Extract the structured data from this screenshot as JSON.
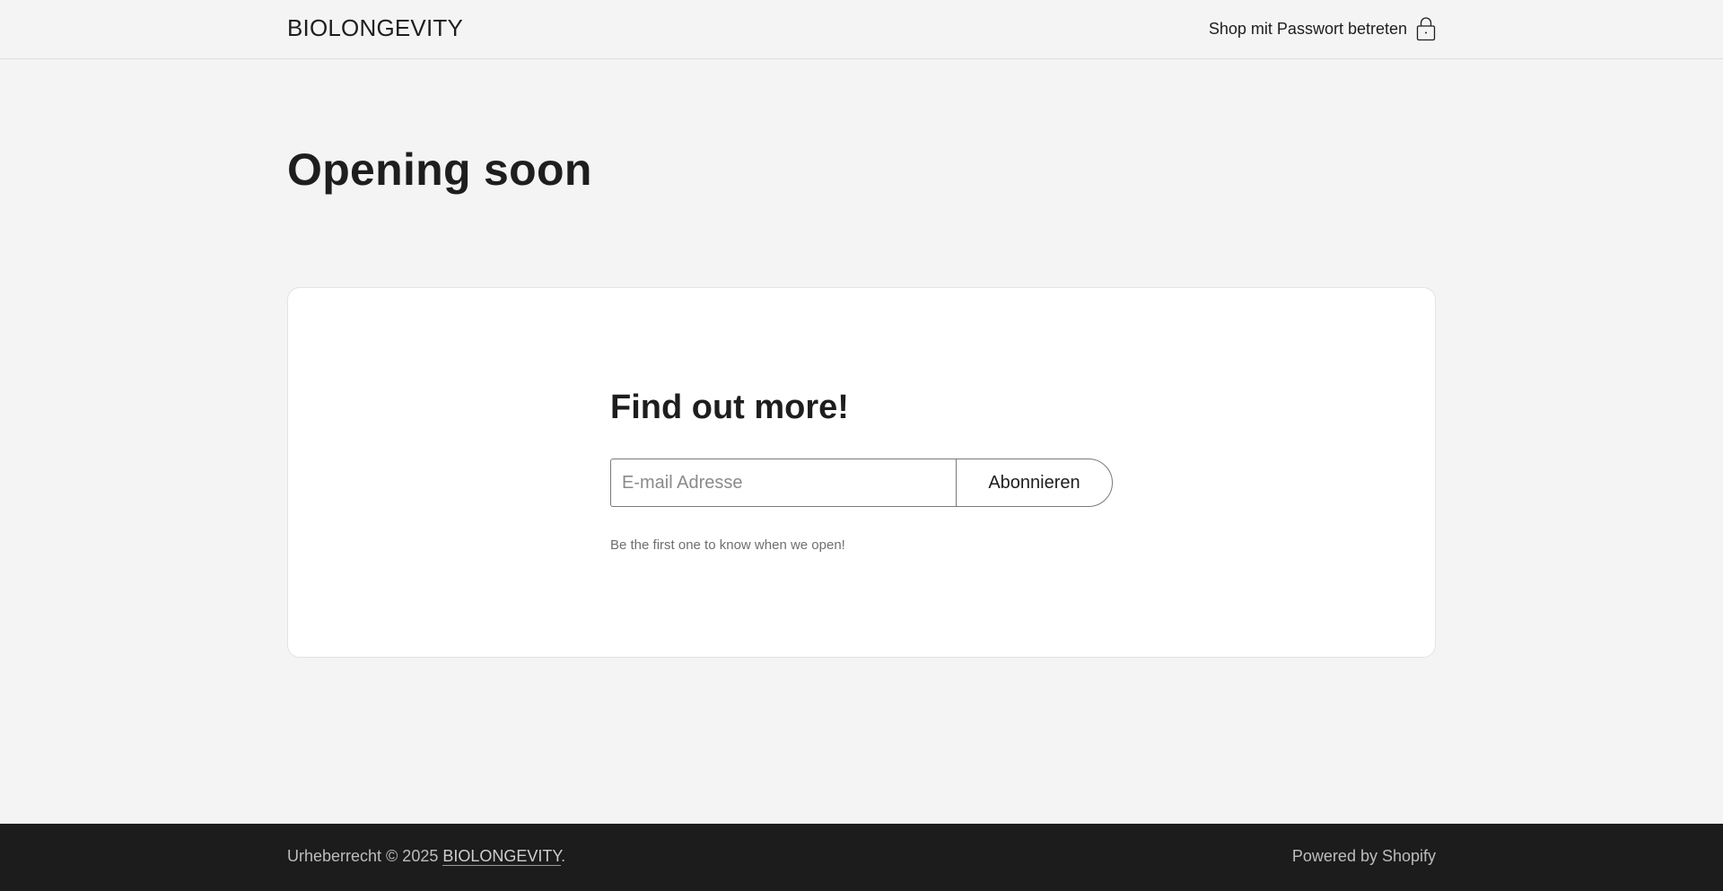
{
  "header": {
    "brand": "BIOLONGEVITY",
    "password_link": "Shop mit Passwort betreten",
    "password_icon": "lock-icon"
  },
  "main": {
    "title": "Opening soon"
  },
  "card": {
    "title": "Find out more!",
    "email_placeholder": "E-mail Adresse",
    "subscribe_label": "Abonnieren",
    "note": "Be the first one to know when we open!"
  },
  "footer": {
    "copyright_prefix": "Urheberrecht © 2025 ",
    "copyright_brand": "BIOLONGEVITY",
    "copyright_suffix": ".",
    "powered_by": "Powered by Shopify"
  },
  "colors": {
    "background": "#f4f4f4",
    "text": "#1e1e1e",
    "footer_bg": "#1c1c1c",
    "card_bg": "#ffffff"
  }
}
